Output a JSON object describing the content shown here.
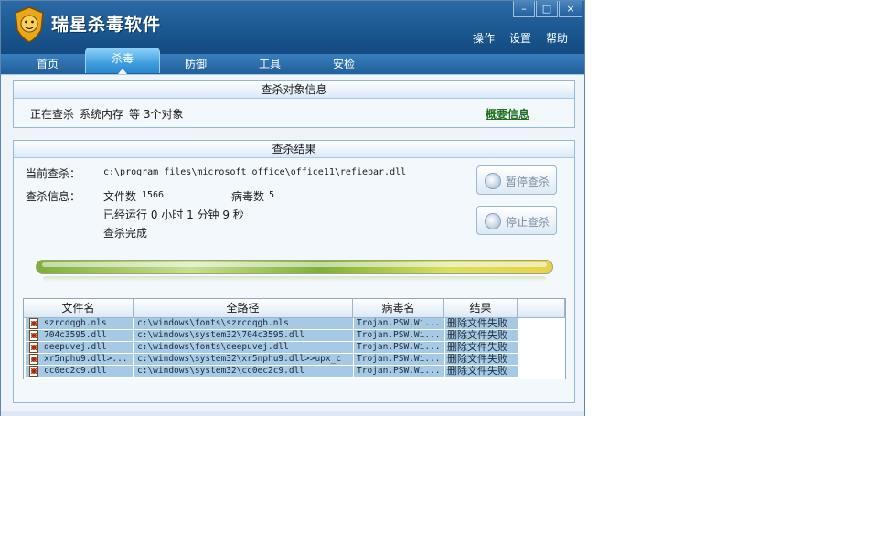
{
  "app": {
    "title": "瑞星杀毒软件"
  },
  "window_controls": {
    "minimize": "–",
    "maximize": "□",
    "close": "×"
  },
  "top_menu": [
    "操作",
    "设置",
    "帮助"
  ],
  "tabs": [
    {
      "label": "首页",
      "active": false
    },
    {
      "label": "杀毒",
      "active": true
    },
    {
      "label": "防御",
      "active": false
    },
    {
      "label": "工具",
      "active": false
    },
    {
      "label": "安检",
      "active": false
    }
  ],
  "target_panel": {
    "title": "查杀对象信息",
    "status_prefix": "正在查杀",
    "object": "系统内存",
    "status_suffix": "等 3个对象",
    "summary_link": "概要信息"
  },
  "result_panel": {
    "title": "查杀结果",
    "current_label": "当前查杀：",
    "current_path": "c:\\program files\\microsoft office\\office11\\refiebar.dll",
    "info_label": "查杀信息：",
    "file_count_label": "文件数",
    "file_count": "1566",
    "virus_count_label": "病毒数",
    "virus_count": "5",
    "elapsed": "已经运行 0 小时 1 分钟 9  秒",
    "done_text": "查杀完成",
    "pause_button": "暂停查杀",
    "stop_button": "停止查杀",
    "progress_fraction": 1.0
  },
  "table": {
    "columns": [
      "文件名",
      "全路径",
      "病毒名",
      "结果"
    ],
    "rows": [
      {
        "file": "szrcdqgb.nls",
        "path": "c:\\windows\\fonts\\szrcdqgb.nls",
        "virus": "Trojan.PSW.Wi...",
        "result": "删除文件失败"
      },
      {
        "file": "704c3595.dll",
        "path": "c:\\windows\\system32\\704c3595.dll",
        "virus": "Trojan.PSW.Wi...",
        "result": "删除文件失败"
      },
      {
        "file": "deepuvej.dll",
        "path": "c:\\windows\\fonts\\deepuvej.dll",
        "virus": "Trojan.PSW.Wi...",
        "result": "删除文件失败"
      },
      {
        "file": "xr5nphu9.dll>...",
        "path": "c:\\windows\\system32\\xr5nphu9.dll>>upx_c",
        "virus": "Trojan.PSW.Wi...",
        "result": "删除文件失败"
      },
      {
        "file": "cc0ec2c9.dll",
        "path": "c:\\windows\\system32\\cc0ec2c9.dll",
        "virus": "Trojan.PSW.Wi...",
        "result": "删除文件失败"
      }
    ]
  },
  "colors": {
    "titlebar": "#1a568f",
    "row_highlight": "#a6c9e6",
    "link": "#207020"
  },
  "icons": {
    "logo": "lion-shield-icon",
    "row": "virus-file-icon",
    "pause": "pause-icon",
    "stop": "stop-icon"
  }
}
